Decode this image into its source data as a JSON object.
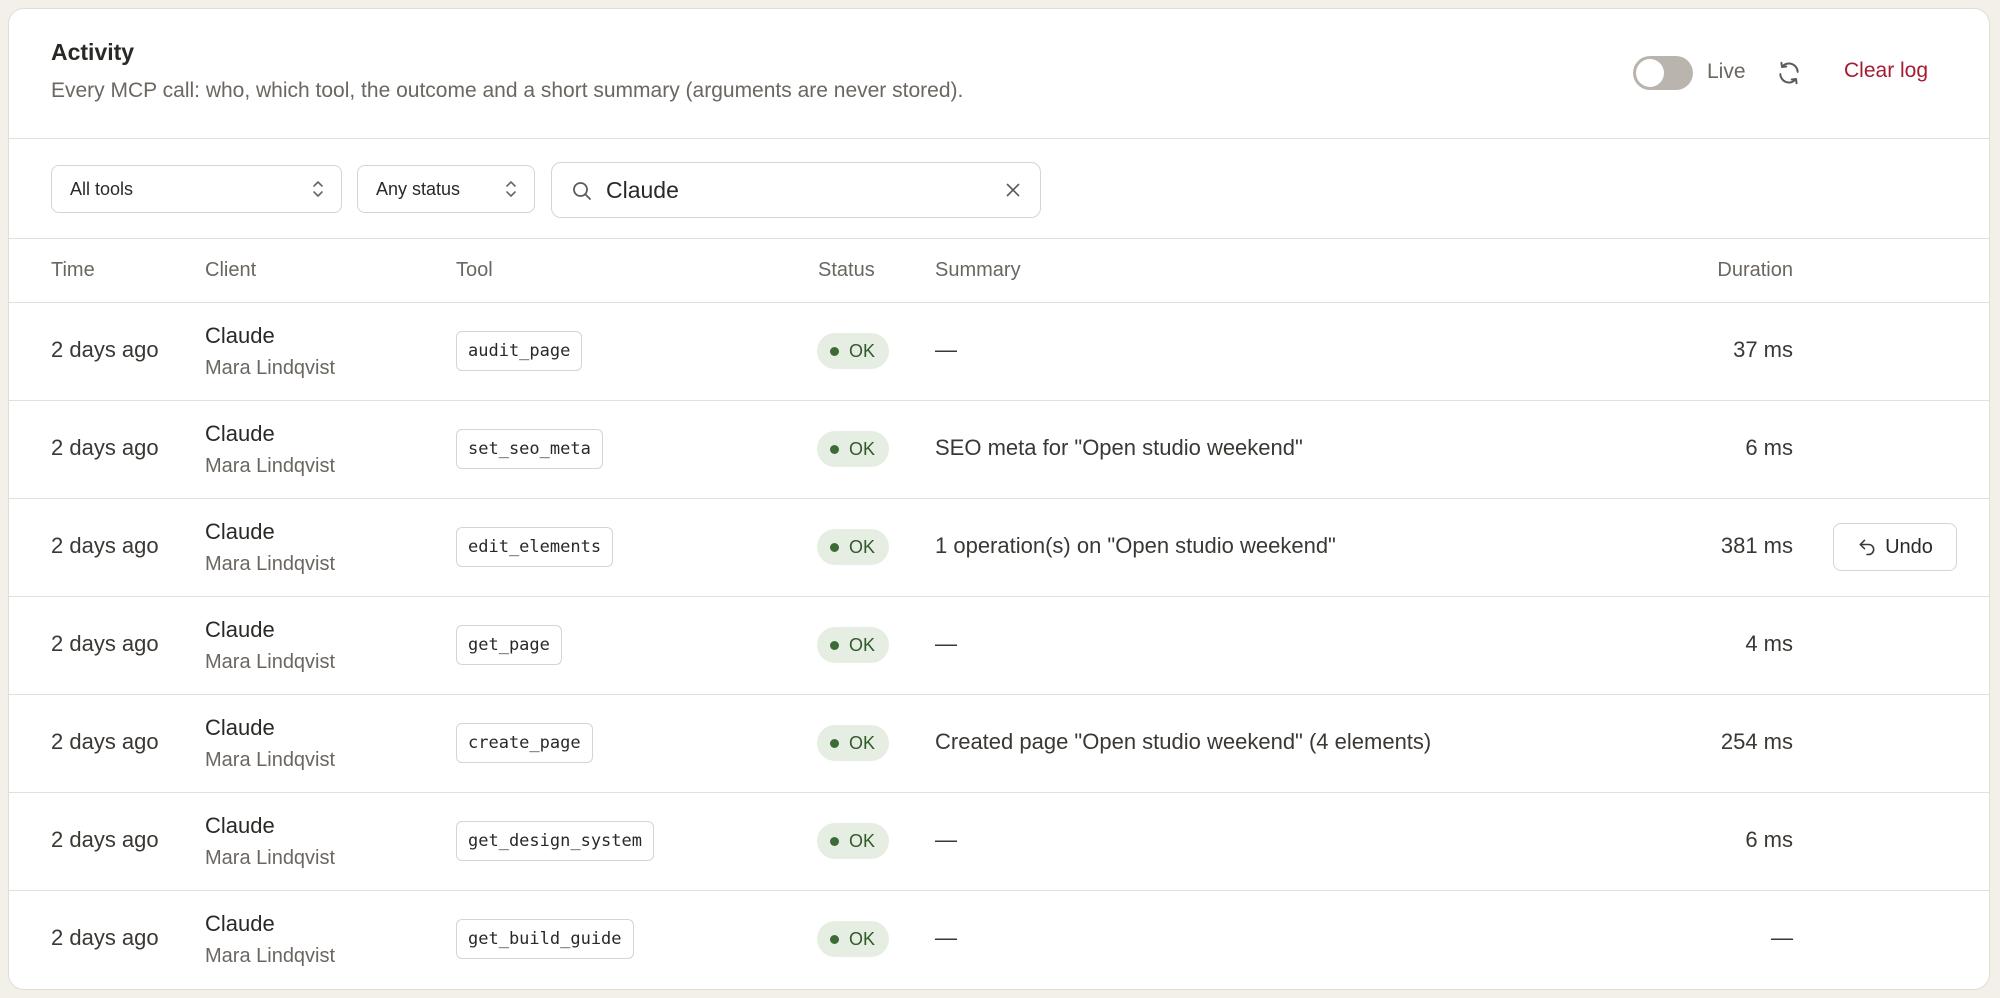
{
  "header": {
    "title": "Activity",
    "subtitle": "Every MCP call: who, which tool, the outcome and a short summary (arguments are never stored).",
    "live_label": "Live",
    "live_enabled": false,
    "refresh_icon": "refresh-icon",
    "clear_log_label": "Clear log"
  },
  "filters": {
    "tool_select": {
      "value": "All tools",
      "icon": "chevron-updown-icon"
    },
    "status_select": {
      "value": "Any status",
      "icon": "chevron-updown-icon"
    },
    "search": {
      "value": "Claude",
      "icon": "search-icon",
      "clear_icon": "close-icon"
    }
  },
  "table": {
    "columns": {
      "time": "Time",
      "client": "Client",
      "tool": "Tool",
      "status": "Status",
      "summary": "Summary",
      "duration": "Duration"
    },
    "rows": [
      {
        "time": "2 days ago",
        "client": "Claude",
        "user": "Mara Lindqvist",
        "tool": "audit_page",
        "status": "OK",
        "summary": "—",
        "duration": "37 ms"
      },
      {
        "time": "2 days ago",
        "client": "Claude",
        "user": "Mara Lindqvist",
        "tool": "set_seo_meta",
        "status": "OK",
        "summary": "SEO meta for \"Open studio weekend\"",
        "duration": "6 ms"
      },
      {
        "time": "2 days ago",
        "client": "Claude",
        "user": "Mara Lindqvist",
        "tool": "edit_elements",
        "status": "OK",
        "summary": "1 operation(s) on \"Open studio weekend\"",
        "duration": "381 ms",
        "action": "Undo"
      },
      {
        "time": "2 days ago",
        "client": "Claude",
        "user": "Mara Lindqvist",
        "tool": "get_page",
        "status": "OK",
        "summary": "—",
        "duration": "4 ms"
      },
      {
        "time": "2 days ago",
        "client": "Claude",
        "user": "Mara Lindqvist",
        "tool": "create_page",
        "status": "OK",
        "summary": "Created page \"Open studio weekend\" (4 elements)",
        "duration": "254 ms"
      },
      {
        "time": "2 days ago",
        "client": "Claude",
        "user": "Mara Lindqvist",
        "tool": "get_design_system",
        "status": "OK",
        "summary": "—",
        "duration": "6 ms"
      },
      {
        "time": "2 days ago",
        "client": "Claude",
        "user": "Mara Lindqvist",
        "tool": "get_build_guide",
        "status": "OK",
        "summary": "—",
        "duration": "—"
      }
    ]
  },
  "colors": {
    "accent_danger": "#a51c30",
    "status_ok_bg": "#e6ede3",
    "status_ok_text": "#2f5a2a",
    "toggle_off": "#b9b4ad"
  }
}
